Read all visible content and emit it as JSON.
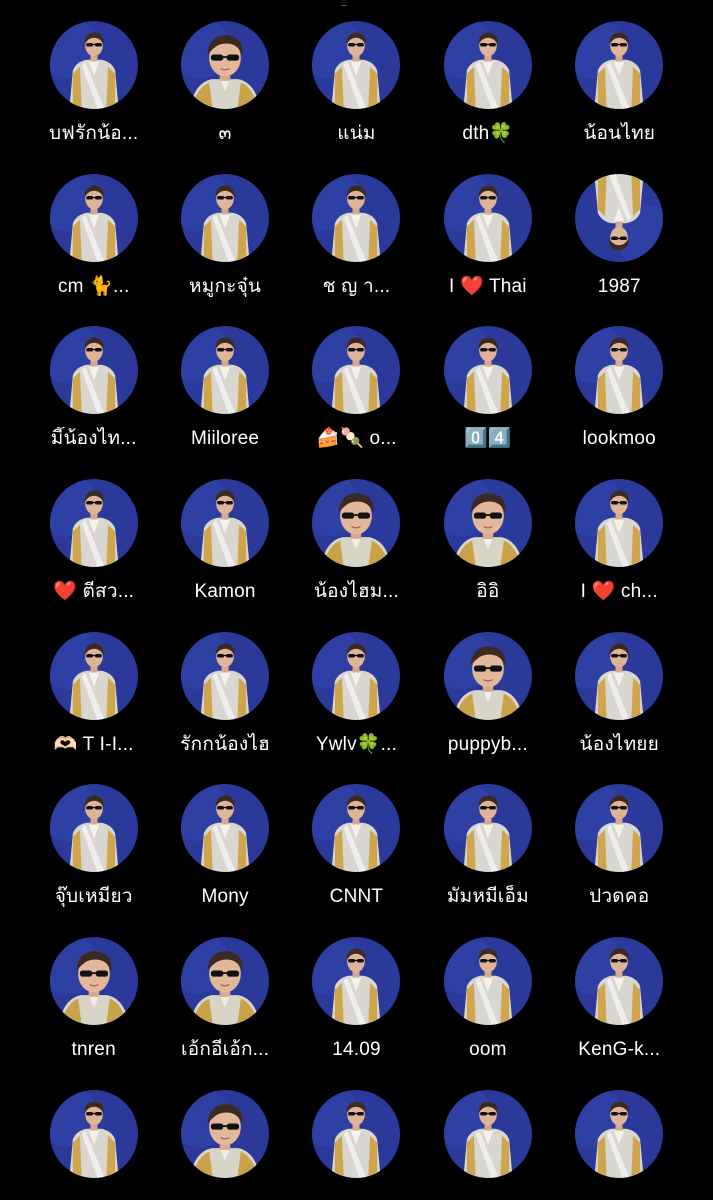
{
  "colors": {
    "background": "#000000",
    "avatar_bg": "#2b3a9a",
    "text": "#ffffff"
  },
  "avatar_icon": "profile-photo-person-sunglasses",
  "profiles": [
    {
      "name": "บฟรักน้อ...",
      "style": "full"
    },
    {
      "name": "๓",
      "style": "close"
    },
    {
      "name": "แน่ม",
      "style": "full"
    },
    {
      "name": "dth🍀",
      "style": "full"
    },
    {
      "name": "น้อนไทย",
      "style": "full"
    },
    {
      "name": "cm 🐈...",
      "style": "full"
    },
    {
      "name": "หมูกะจุ๋น",
      "style": "full"
    },
    {
      "name": "ช ญ า...",
      "style": "full"
    },
    {
      "name": "I ❤️ Thai",
      "style": "full"
    },
    {
      "name": "1987",
      "style": "flip"
    },
    {
      "name": "มี๊น้องไท...",
      "style": "full"
    },
    {
      "name": "Miiloree",
      "style": "full"
    },
    {
      "name": "🍰🍡 o...",
      "style": "full"
    },
    {
      "name": "0️⃣4️⃣",
      "style": "full"
    },
    {
      "name": "lookmoo",
      "style": "full"
    },
    {
      "name": "❤️ ตี่สว...",
      "style": "full"
    },
    {
      "name": "Kamon",
      "style": "full"
    },
    {
      "name": "น้องไฮม...",
      "style": "close"
    },
    {
      "name": "อิอิ",
      "style": "close"
    },
    {
      "name": "I ❤️ ch...",
      "style": "full"
    },
    {
      "name": "🫶🏻 T I-I...",
      "style": "full"
    },
    {
      "name": "รักกน้องไฮ",
      "style": "full"
    },
    {
      "name": "Ywlv🍀...",
      "style": "full"
    },
    {
      "name": "puppyb...",
      "style": "close"
    },
    {
      "name": "น้องไทยย",
      "style": "full"
    },
    {
      "name": "จุ๊บเหมียว",
      "style": "full"
    },
    {
      "name": "Mony",
      "style": "full"
    },
    {
      "name": "CNNT",
      "style": "full"
    },
    {
      "name": "มัมหมีเอ็ม",
      "style": "full"
    },
    {
      "name": "ปวดคอ",
      "style": "full"
    },
    {
      "name": "tnren",
      "style": "close"
    },
    {
      "name": "เอ้กอีเอ้ก...",
      "style": "close"
    },
    {
      "name": "14.09",
      "style": "full"
    },
    {
      "name": "oom",
      "style": "full"
    },
    {
      "name": "KenG-k...",
      "style": "full"
    },
    {
      "name": "",
      "style": "full"
    },
    {
      "name": "",
      "style": "close"
    },
    {
      "name": "",
      "style": "full"
    },
    {
      "name": "",
      "style": "full"
    },
    {
      "name": "",
      "style": "full"
    }
  ]
}
